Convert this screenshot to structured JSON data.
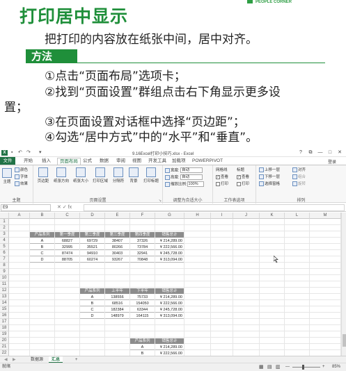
{
  "header": {
    "title": "打印居中显示",
    "intro": "把打印的内容放在纸张中间，居中对齐。",
    "section_label": "方法",
    "steps": [
      "①点击“页面布局”选项卡；",
      "②找到“页面设置”群组点击右下角显示更多设",
      "置；",
      "③在页面设置对话框中选择“页边距”；",
      "④勾选“居中方式”中的“水平”和“垂直”。"
    ],
    "corner_badge": "PEOPLE CORNER"
  },
  "excel": {
    "window_title": "9.16Excel打印小技巧.xlsx - Excel",
    "app_icon": "X",
    "window_buttons": [
      "?",
      "⧉",
      "—",
      "□",
      "✕"
    ],
    "login": "登录",
    "tabs": [
      {
        "label": "文件"
      },
      {
        "label": "开始"
      },
      {
        "label": "插入"
      },
      {
        "label": "页面布局",
        "active": true
      },
      {
        "label": "公式"
      },
      {
        "label": "数据"
      },
      {
        "label": "审阅"
      },
      {
        "label": "视图"
      },
      {
        "label": "开发工具"
      },
      {
        "label": "加载项"
      },
      {
        "label": "POWERPIVOT"
      }
    ],
    "ribbon": {
      "theme_group": {
        "label": "主题",
        "big": "主题",
        "items": [
          "颜色",
          "字体",
          "效果"
        ]
      },
      "page_setup_group": {
        "label": "页面设置",
        "buttons": [
          "页边距",
          "纸张方向",
          "纸张大小",
          "打印区域",
          "分隔符",
          "背景",
          "打印标题"
        ]
      },
      "scale_group": {
        "label": "调整为合适大小",
        "rows": [
          {
            "label": "宽度:",
            "value": "自动"
          },
          {
            "label": "高度:",
            "value": "自动"
          },
          {
            "label": "缩放比例:",
            "value": "100%"
          }
        ]
      },
      "sheet_options_group": {
        "label": "工作表选项",
        "cols": [
          "网格线",
          "标题"
        ],
        "view_label": "查看",
        "print_label": "打印"
      },
      "arrange_group": {
        "label": "排列",
        "items": [
          "上移一层",
          "下移一层",
          "选择窗格",
          "对齐",
          "组合",
          "旋转"
        ]
      }
    },
    "name_box": "E9",
    "formula_icons": [
      "✕",
      "✓",
      "fx"
    ],
    "formula_value": "",
    "columns": [
      "A",
      "B",
      "C",
      "D",
      "E",
      "F",
      "G",
      "H",
      "I",
      "J",
      "K",
      "L",
      "M"
    ],
    "rows": [
      "1",
      "2",
      "3",
      "4",
      "5",
      "6",
      "7",
      "8",
      "9",
      "10",
      "11",
      "12",
      "13",
      "14",
      "15",
      "16",
      "17",
      "18",
      "19",
      "20",
      "21",
      "22"
    ],
    "table1": {
      "headers": [
        "产品系列",
        "第一季度",
        "第二季度",
        "第三季度",
        "第四季度",
        "销售总计"
      ],
      "rows": [
        [
          "A",
          "68827",
          "69729",
          "38407",
          "37326",
          "¥ 214,289.00"
        ],
        [
          "B",
          "32995",
          "35521",
          "80266",
          "73784",
          "¥ 222,566.00"
        ],
        [
          "C",
          "87474",
          "94910",
          "30403",
          "32941",
          "¥ 245,728.00"
        ],
        [
          "D",
          "88705",
          "60274",
          "93267",
          "70848",
          "¥ 313,094.00"
        ]
      ]
    },
    "table2": {
      "headers": [
        "产品系列",
        "上半年",
        "下半年",
        "销售总计"
      ],
      "rows": [
        [
          "A",
          "138556",
          "75733",
          "¥ 214,289.00"
        ],
        [
          "B",
          "68516",
          "154050",
          "¥ 222,566.00"
        ],
        [
          "C",
          "182384",
          "63344",
          "¥ 245,728.00"
        ],
        [
          "D",
          "148979",
          "164115",
          "¥ 313,094.00"
        ]
      ]
    },
    "table3": {
      "headers": [
        "产品系列",
        "销售总计"
      ],
      "rows": [
        [
          "A",
          "¥ 214,289.00"
        ],
        [
          "B",
          "¥ 222,566.00"
        ]
      ]
    },
    "sheet_tabs": [
      "数据源",
      "汇总"
    ],
    "active_sheet": "汇总",
    "add_sheet": "+",
    "status": "就绪",
    "zoom": "85%",
    "zoom_minus": "—",
    "zoom_plus": "+"
  }
}
